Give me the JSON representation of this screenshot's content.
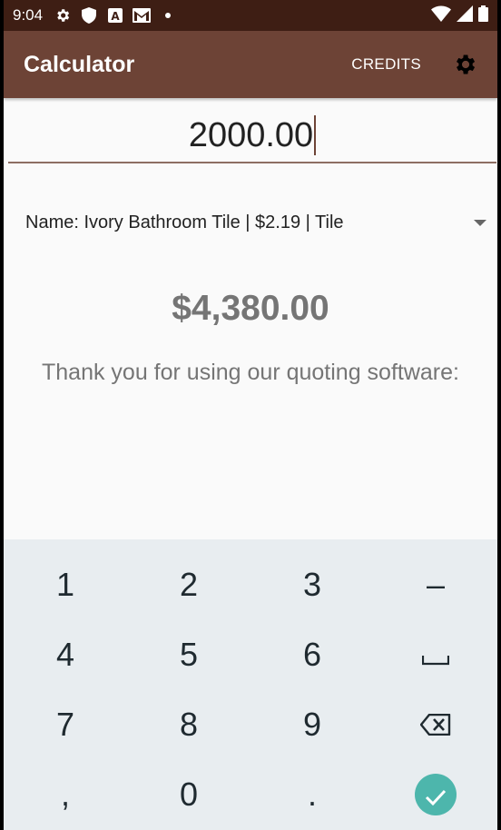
{
  "status_bar": {
    "time": "9:04",
    "left_icons": [
      "gear-icon",
      "shield-icon",
      "a-box-icon",
      "gmail-icon",
      "dot-icon"
    ],
    "right_icons": [
      "wifi-icon",
      "signal-icon",
      "battery-icon"
    ]
  },
  "app_bar": {
    "title": "Calculator",
    "credits_label": "CREDITS",
    "settings_icon": "gear-icon",
    "color": "#6d4336"
  },
  "input": {
    "value": "2000.00"
  },
  "dropdown": {
    "selected": "Name: Ivory Bathroom Tile | $2.19 | Tile"
  },
  "result": {
    "total": "$4,380.00",
    "thanks": "Thank you for using our quoting software:"
  },
  "keypad": {
    "keys": [
      {
        "label": "1",
        "name": "key-1"
      },
      {
        "label": "2",
        "name": "key-2"
      },
      {
        "label": "3",
        "name": "key-3"
      },
      {
        "label": "–",
        "name": "key-minus"
      },
      {
        "label": "4",
        "name": "key-4"
      },
      {
        "label": "5",
        "name": "key-5"
      },
      {
        "label": "6",
        "name": "key-6"
      },
      {
        "label": "space",
        "name": "key-space",
        "icon": "space-bar-icon"
      },
      {
        "label": "7",
        "name": "key-7"
      },
      {
        "label": "8",
        "name": "key-8"
      },
      {
        "label": "9",
        "name": "key-9"
      },
      {
        "label": "backspace",
        "name": "key-backspace",
        "icon": "backspace-icon"
      },
      {
        "label": ",",
        "name": "key-comma"
      },
      {
        "label": "0",
        "name": "key-0"
      },
      {
        "label": ".",
        "name": "key-period"
      },
      {
        "label": "done",
        "name": "key-done",
        "icon": "check-icon"
      }
    ],
    "accent": "#4db6ac"
  }
}
